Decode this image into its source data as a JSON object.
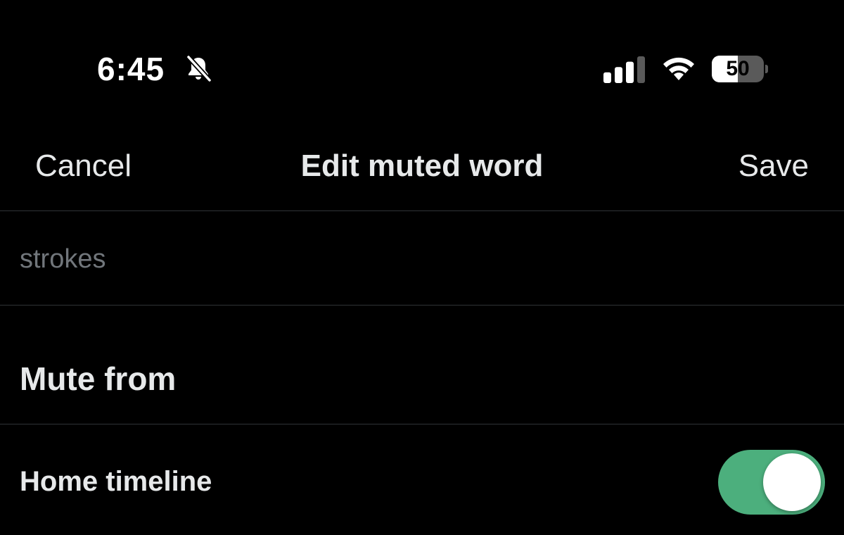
{
  "status_bar": {
    "time": "6:45",
    "bell_icon": "bell-slash-icon",
    "signal_icon": "cellular-signal-icon",
    "signal_bars_active": 3,
    "signal_bars_total": 4,
    "wifi_icon": "wifi-icon",
    "battery_level": "50",
    "battery_fraction": 0.5
  },
  "nav": {
    "cancel_label": "Cancel",
    "title": "Edit muted word",
    "save_label": "Save"
  },
  "word_input": {
    "value": "strokes",
    "placeholder": ""
  },
  "mute_from": {
    "title": "Mute from",
    "options": [
      {
        "label": "Home timeline",
        "enabled": true
      }
    ]
  },
  "colors": {
    "background": "#000000",
    "text": "#e7e9ea",
    "muted_text": "#71767b",
    "divider": "#2f3336",
    "toggle_on": "#4caf7d"
  }
}
